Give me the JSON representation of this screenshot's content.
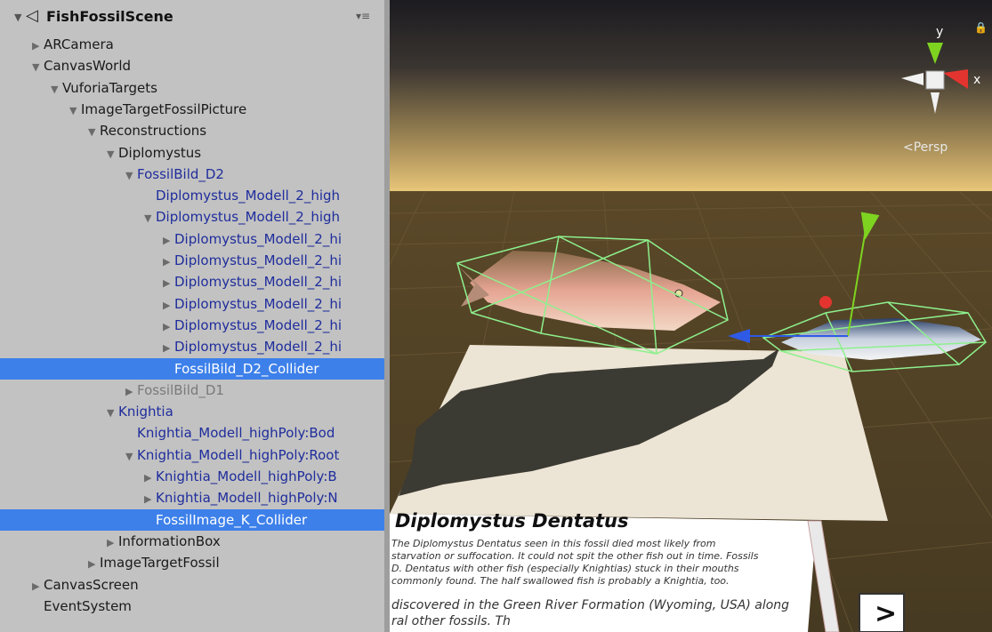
{
  "hierarchy": {
    "scene_name": "FishFossilScene",
    "rows": [
      {
        "label": "ARCamera",
        "indent": 0,
        "arrow": "right",
        "style": "normal"
      },
      {
        "label": "CanvasWorld",
        "indent": 0,
        "arrow": "down",
        "style": "normal"
      },
      {
        "label": "VuforiaTargets",
        "indent": 1,
        "arrow": "down",
        "style": "normal"
      },
      {
        "label": "ImageTargetFossilPicture",
        "indent": 2,
        "arrow": "down",
        "style": "normal"
      },
      {
        "label": "Reconstructions",
        "indent": 3,
        "arrow": "down",
        "style": "normal"
      },
      {
        "label": "Diplomystus",
        "indent": 4,
        "arrow": "down",
        "style": "normal"
      },
      {
        "label": "FossilBild_D2",
        "indent": 5,
        "arrow": "down",
        "style": "blue"
      },
      {
        "label": "Diplomystus_Modell_2_high",
        "indent": 6,
        "arrow": "none",
        "style": "blue"
      },
      {
        "label": "Diplomystus_Modell_2_high",
        "indent": 6,
        "arrow": "down",
        "style": "blue"
      },
      {
        "label": "Diplomystus_Modell_2_hi",
        "indent": 7,
        "arrow": "right",
        "style": "blue"
      },
      {
        "label": "Diplomystus_Modell_2_hi",
        "indent": 7,
        "arrow": "right",
        "style": "blue"
      },
      {
        "label": "Diplomystus_Modell_2_hi",
        "indent": 7,
        "arrow": "right",
        "style": "blue"
      },
      {
        "label": "Diplomystus_Modell_2_hi",
        "indent": 7,
        "arrow": "right",
        "style": "blue"
      },
      {
        "label": "Diplomystus_Modell_2_hi",
        "indent": 7,
        "arrow": "right",
        "style": "blue"
      },
      {
        "label": "Diplomystus_Modell_2_hi",
        "indent": 7,
        "arrow": "right",
        "style": "blue"
      },
      {
        "label": "FossilBild_D2_Collider",
        "indent": 7,
        "arrow": "none",
        "style": "selected"
      },
      {
        "label": "FossilBild_D1",
        "indent": 5,
        "arrow": "right",
        "style": "disabled"
      },
      {
        "label": "Knightia",
        "indent": 4,
        "arrow": "down",
        "style": "blue"
      },
      {
        "label": "Knightia_Modell_highPoly:Bod",
        "indent": 5,
        "arrow": "none",
        "style": "blue"
      },
      {
        "label": "Knightia_Modell_highPoly:Root",
        "indent": 5,
        "arrow": "down",
        "style": "blue"
      },
      {
        "label": "Knightia_Modell_highPoly:B",
        "indent": 6,
        "arrow": "right",
        "style": "blue"
      },
      {
        "label": "Knightia_Modell_highPoly:N",
        "indent": 6,
        "arrow": "right",
        "style": "blue"
      },
      {
        "label": "FossilImage_K_Collider",
        "indent": 6,
        "arrow": "none",
        "style": "selected"
      },
      {
        "label": "InformationBox",
        "indent": 4,
        "arrow": "right",
        "style": "normal"
      },
      {
        "label": "ImageTargetFossil",
        "indent": 3,
        "arrow": "right",
        "style": "normal"
      },
      {
        "label": "CanvasScreen",
        "indent": 0,
        "arrow": "right",
        "style": "normal"
      },
      {
        "label": "EventSystem",
        "indent": 0,
        "arrow": "none",
        "style": "normal"
      }
    ]
  },
  "scene": {
    "gizmo_y": "y",
    "gizmo_x": "x",
    "projection_label": "Persp",
    "info_title": "Diplomystus Dentatus",
    "info_line_1": "The Diplomystus Dentatus seen in this fossil died most likely from",
    "info_line_2": "starvation or suffocation. It could not spit the other fish out in time. Fossils",
    "info_line_3": "D. Dentatus with other fish (especially Knightias) stuck in their mouths",
    "info_line_4": "commonly found. The half swallowed fish is probably a Knightia, too.",
    "info_line_5": "discovered in the Green River Formation (Wyoming, USA) along",
    "info_line_6": "ral other fossils. Th",
    "button_label": ">"
  },
  "colors": {
    "selection": "#3d80ea",
    "prefab_blue": "#1f2d9c",
    "collider_green": "#8df08d",
    "axis_y": "#7ed321",
    "axis_x": "#e3342f",
    "axis_z": "#2e5ae6"
  }
}
